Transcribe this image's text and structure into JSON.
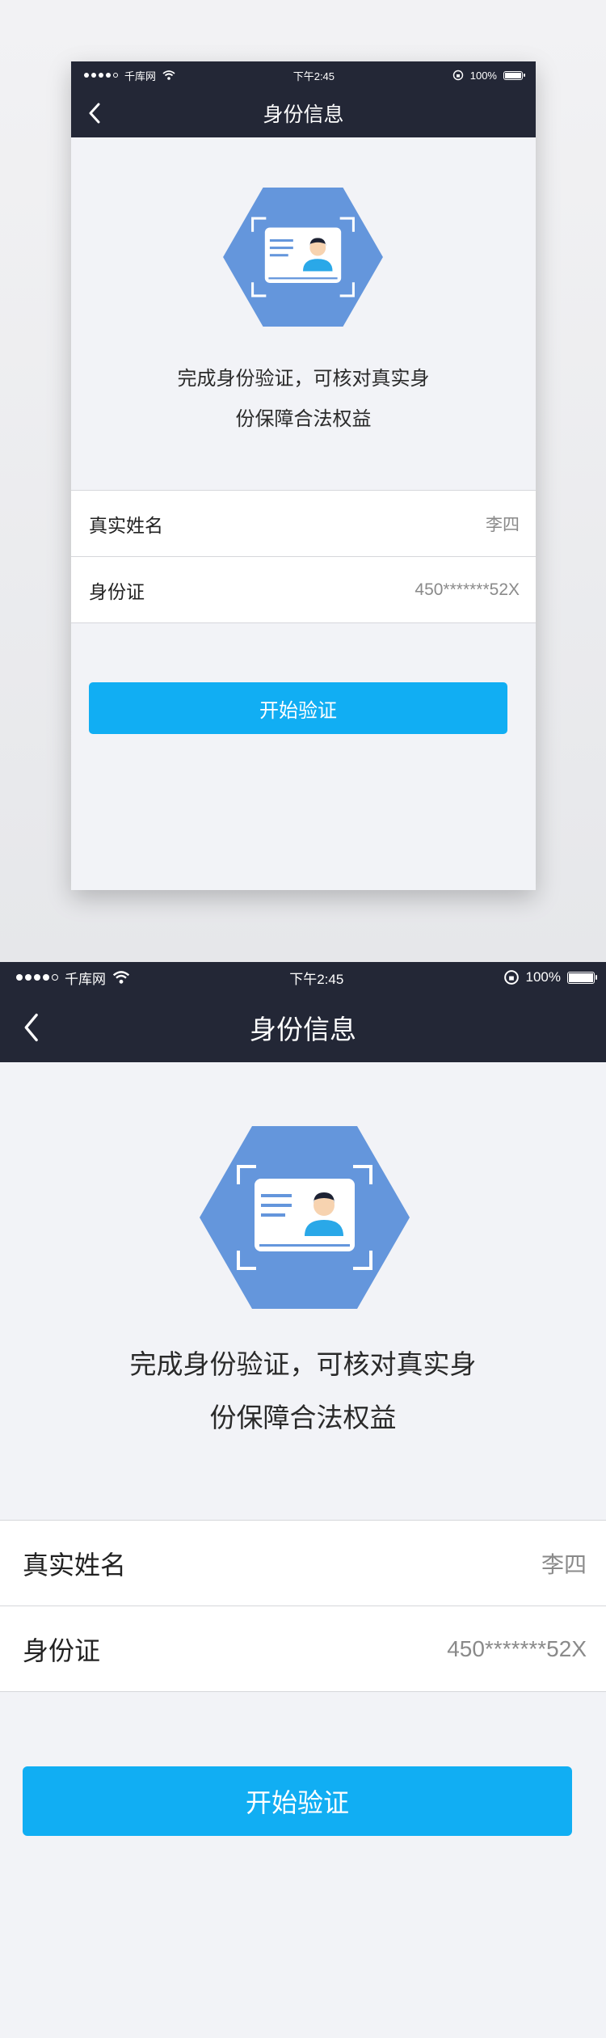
{
  "status_bar": {
    "carrier": "千库网",
    "time": "下午2:45",
    "battery_percent_label": "100%",
    "battery_level": 1.0,
    "signal_bars_filled": 4,
    "signal_bars_total": 5
  },
  "nav": {
    "title": "身份信息"
  },
  "description": {
    "line1": "完成身份验证，可核对真实身",
    "line2": "份保障合法权益"
  },
  "form": {
    "rows": [
      {
        "label": "真实姓名",
        "value": "李四"
      },
      {
        "label": "身份证",
        "value": "450*******52X"
      }
    ]
  },
  "actions": {
    "start_label": "开始验证"
  },
  "colors": {
    "header_bg": "#232736",
    "page_bg": "#f2f3f7",
    "accent": "#11aef3",
    "hexagon": "#6496dc",
    "avatar_body": "#2aa8e8"
  }
}
